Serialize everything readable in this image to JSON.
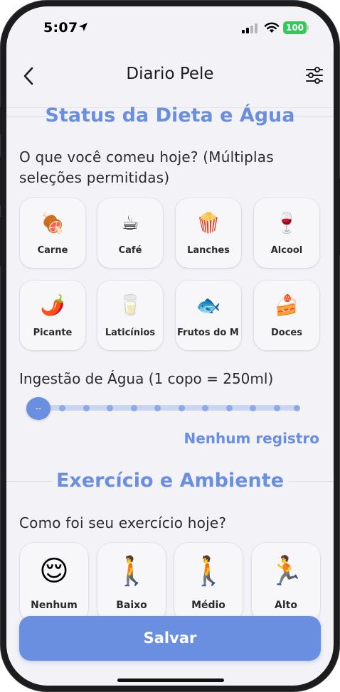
{
  "status_bar": {
    "time": "5:07",
    "battery": "100"
  },
  "nav": {
    "title": "Diario Pele",
    "back_icon": "chevron-left-icon",
    "filter_icon": "sliders-icon"
  },
  "diet": {
    "section_title": "Status da Dieta e Água",
    "question": "O que você comeu hoje? (Múltiplas seleções permitidas)",
    "items": [
      {
        "emoji": "🍖",
        "label": "Carne"
      },
      {
        "emoji": "☕",
        "label": "Café"
      },
      {
        "emoji": "🍿",
        "label": "Lanches"
      },
      {
        "emoji": "🍷",
        "label": "Álcool"
      },
      {
        "emoji": "🌶️",
        "label": "Picante"
      },
      {
        "emoji": "🥛",
        "label": "Laticínios"
      },
      {
        "emoji": "🐟",
        "label": "Frutos do M···"
      },
      {
        "emoji": "🍰",
        "label": "Doces"
      }
    ]
  },
  "water": {
    "label": "Ingestão de Água  (1 copo = 250ml)",
    "knob_text": "--",
    "max_cups": 12,
    "current_cups": 0,
    "status": "Nenhum registro"
  },
  "exercise": {
    "section_title": "Exercício e Ambiente",
    "question": "Como foi seu exercício hoje?",
    "items": [
      {
        "emoji": "😌",
        "label": "Nenhum"
      },
      {
        "emoji": "🚶",
        "label": "Baixo"
      },
      {
        "emoji": "🚶",
        "label": "Médio"
      },
      {
        "emoji": "🏃",
        "label": "Alto"
      }
    ]
  },
  "save_button": "Salvar",
  "colors": {
    "accent": "#6a8fe0",
    "background": "#f2f2f7",
    "battery": "#34c759"
  }
}
